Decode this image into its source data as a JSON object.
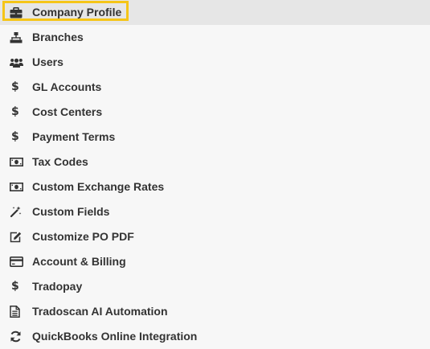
{
  "menu": {
    "items": [
      {
        "label": "Company Profile",
        "icon": "briefcase-icon",
        "active": true,
        "highlighted": true
      },
      {
        "label": "Branches",
        "icon": "sitemap-icon"
      },
      {
        "label": "Users",
        "icon": "users-icon"
      },
      {
        "label": "GL Accounts",
        "icon": "dollar-icon"
      },
      {
        "label": "Cost Centers",
        "icon": "dollar-icon"
      },
      {
        "label": "Payment Terms",
        "icon": "dollar-icon"
      },
      {
        "label": "Tax Codes",
        "icon": "money-bill-icon"
      },
      {
        "label": "Custom Exchange Rates",
        "icon": "money-bill-icon"
      },
      {
        "label": "Custom Fields",
        "icon": "magic-wand-icon"
      },
      {
        "label": "Customize PO PDF",
        "icon": "edit-icon"
      },
      {
        "label": "Account & Billing",
        "icon": "credit-card-icon"
      },
      {
        "label": "Tradopay",
        "icon": "dollar-icon"
      },
      {
        "label": "Tradoscan AI Automation",
        "icon": "file-text-icon"
      },
      {
        "label": "QuickBooks Online Integration",
        "icon": "sync-icon"
      }
    ]
  },
  "colors": {
    "highlight": "#f5c518",
    "active_background": "#e6e6e6",
    "background": "#f7f7f7",
    "text": "#333333"
  }
}
